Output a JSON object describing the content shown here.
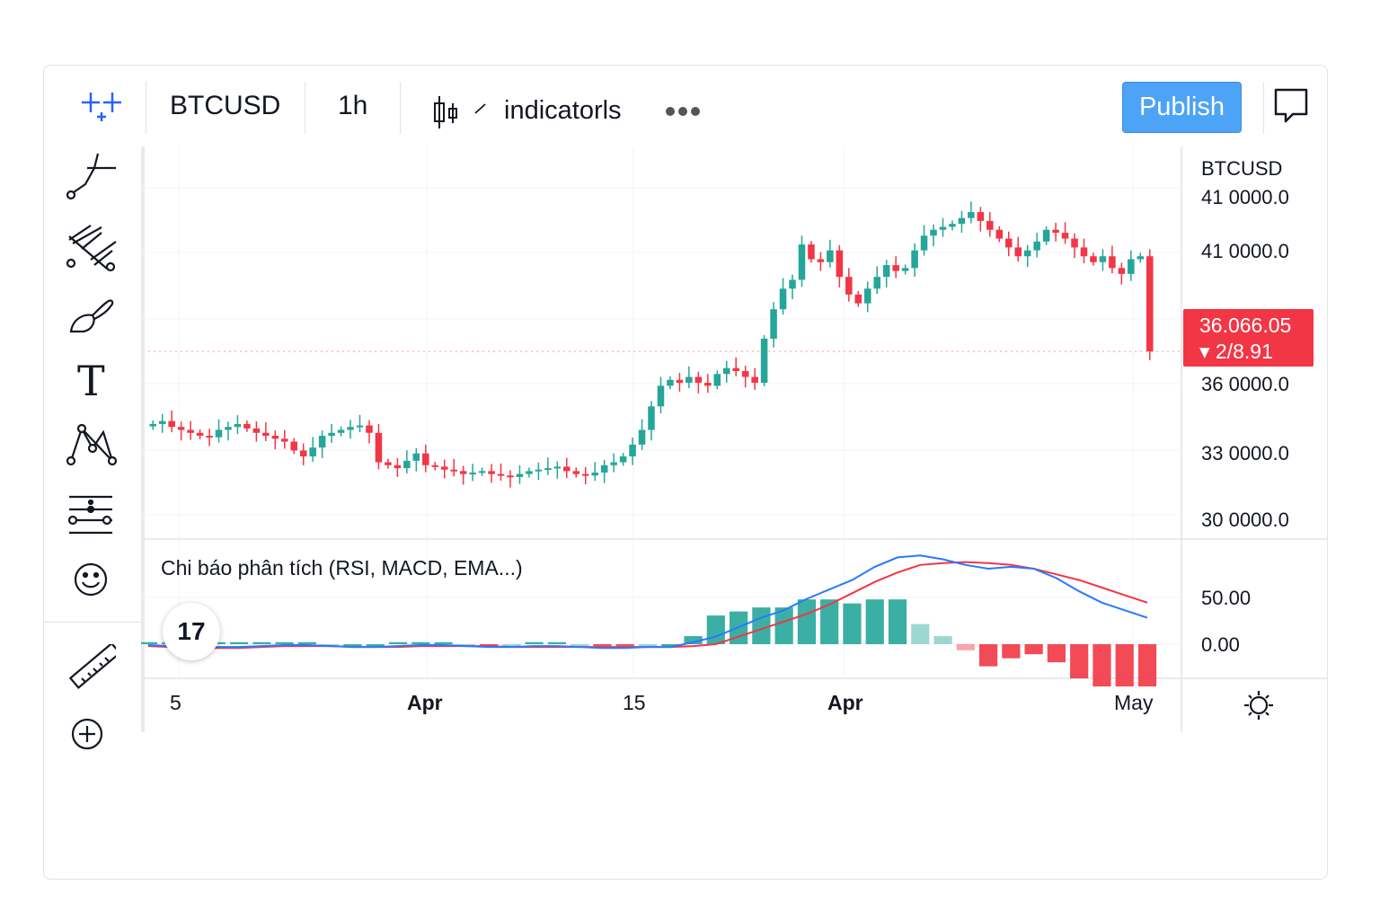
{
  "toolbar": {
    "symbol": "BTCUSD",
    "interval": "1h",
    "indicators_label": "indicatorls",
    "publish_label": "Publish"
  },
  "price_scale": {
    "symbol": "BTCUSD",
    "labels": [
      "41 0000.0",
      "41 0000.0",
      "36 0000.0",
      "33 0000.0",
      "30 0000.0"
    ],
    "current_price": "36.066.05",
    "change": "▾ 2/8.91"
  },
  "indicator_pane": {
    "title": "Chi báo phân tích (RSI, MACD, EMA...)",
    "scale_labels": [
      "50.00",
      "0.00"
    ],
    "logo_text": "17"
  },
  "time_axis": {
    "labels": [
      "5",
      "Apr",
      "15",
      "Apr",
      "May"
    ]
  },
  "colors": {
    "up": "#26a69a",
    "down": "#f23645",
    "accent": "#2962ff",
    "publish": "#4da3f5",
    "macd_line": "#2979ff",
    "signal_line": "#f23645"
  },
  "icons": [
    "crosshair-icon",
    "trendline-icon",
    "pitchfork-icon",
    "brush-icon",
    "text-icon",
    "pattern-icon",
    "fib-icon",
    "emoji-icon",
    "ruler-icon",
    "zoom-in-icon",
    "chart-type-icon",
    "more-icon",
    "chat-icon",
    "settings-icon"
  ],
  "chart_data": {
    "type": "candlestick",
    "symbol": "BTCUSD",
    "interval": "1h",
    "x_ticks": [
      "5",
      "Apr",
      "15",
      "Apr",
      "May"
    ],
    "y_ticks": [
      "30 0000.0",
      "33 0000.0",
      "36 0000.0",
      "41 0000.0",
      "41 0000.0"
    ],
    "close_path": [
      33600,
      33700,
      33500,
      33400,
      33300,
      33200,
      33150,
      33400,
      33500,
      33600,
      33450,
      33300,
      33200,
      33100,
      33000,
      32700,
      32500,
      32800,
      33200,
      33300,
      33400,
      33500,
      33550,
      33300,
      32300,
      32200,
      32100,
      32350,
      32600,
      32200,
      32150,
      32050,
      32000,
      31900,
      31950,
      32000,
      31900,
      31850,
      31800,
      31900,
      32000,
      32050,
      32100,
      32150,
      32000,
      31900,
      31850,
      31950,
      32200,
      32300,
      32500,
      32900,
      33400,
      34200,
      34900,
      35100,
      35000,
      35200,
      35000,
      34900,
      35300,
      35500,
      35400,
      35200,
      35000,
      36500,
      37500,
      38200,
      38500,
      39700,
      39200,
      39100,
      39500,
      38600,
      38000,
      37700,
      38200,
      38600,
      39000,
      38800,
      38900,
      39500,
      40000,
      40200,
      40300,
      40400,
      40600,
      40800,
      40500,
      40200,
      39900,
      39600,
      39300,
      39500,
      39800,
      40200,
      40100,
      39900,
      39600,
      39300,
      39100,
      39300,
      38900,
      38700,
      39200,
      39300,
      36066
    ],
    "macd": [
      -1,
      -2,
      -3,
      -3,
      -3,
      -2,
      -1,
      -1,
      -2,
      -3,
      -3,
      -2,
      -1,
      -1,
      -2,
      -3,
      -3,
      -2,
      -2,
      -3,
      -4,
      -4,
      -3,
      -3,
      2,
      8,
      18,
      28,
      36,
      48,
      58,
      68,
      82,
      92,
      94,
      90,
      84,
      80,
      82,
      80,
      70,
      56,
      44,
      36,
      28
    ],
    "signal": [
      -2,
      -3,
      -4,
      -4,
      -4,
      -3,
      -2,
      -2,
      -2,
      -3,
      -3,
      -3,
      -2,
      -2,
      -2,
      -2,
      -3,
      -3,
      -3,
      -3,
      -3,
      -3,
      -3,
      -3,
      -2,
      0,
      8,
      16,
      24,
      32,
      42,
      54,
      66,
      76,
      84,
      86,
      87,
      86,
      84,
      80,
      74,
      68,
      60,
      52,
      44
    ],
    "macd_scale": [
      "50.00",
      "0.00"
    ]
  }
}
